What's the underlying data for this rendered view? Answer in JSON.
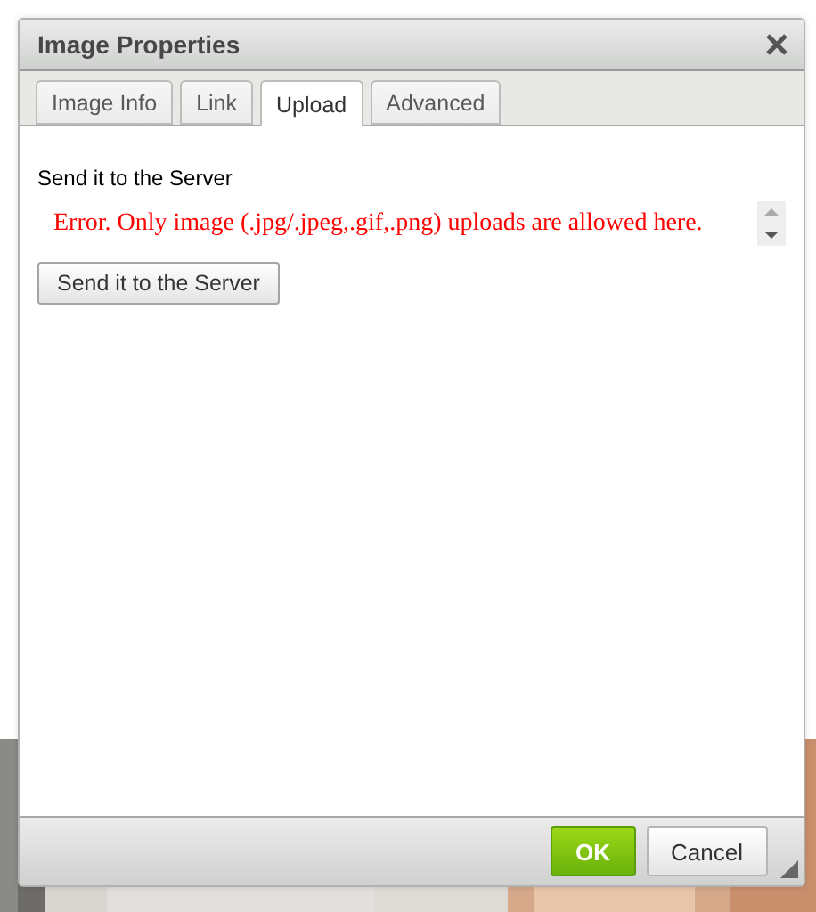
{
  "dialog": {
    "title": "Image Properties",
    "tabs": [
      {
        "label": "Image Info",
        "selected": false
      },
      {
        "label": "Link",
        "selected": false
      },
      {
        "label": "Upload",
        "selected": true
      },
      {
        "label": "Advanced",
        "selected": false
      }
    ],
    "upload": {
      "label": "Send it to the Server",
      "error": "Error. Only image (.jpg/.jpeg,.gif,.png) uploads are allowed here.",
      "button": "Send it to the Server"
    },
    "buttons": [
      {
        "label": "OK",
        "kind": "primary"
      },
      {
        "label": "Cancel",
        "kind": "secondary"
      }
    ]
  }
}
